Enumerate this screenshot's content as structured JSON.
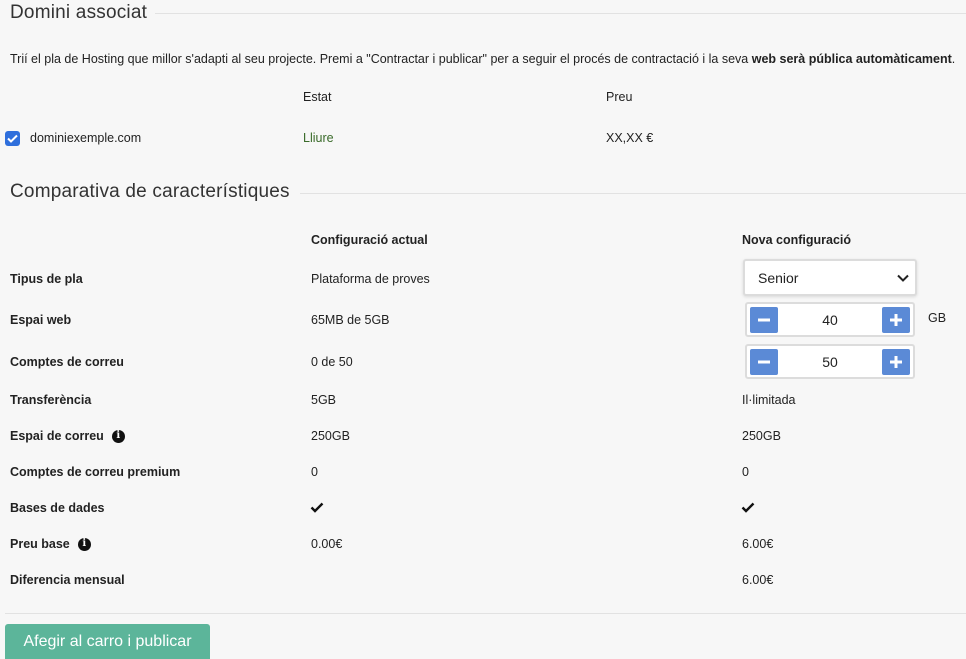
{
  "domain_section": {
    "title": "Domini associat",
    "intro_text": "Trií el pla de Hosting que millor s'adapti al seu projecte. Premi a \"Contractar i publicar\" per a seguir el procés de contractació i la seva ",
    "intro_bold": "web serà pública automàticament",
    "intro_end": ".",
    "col_status": "Estat",
    "col_price": "Preu",
    "domain": {
      "name": "dominiexemple.com",
      "checked": true,
      "status": "Lliure",
      "price": "XX,XX €"
    }
  },
  "comparison": {
    "title": "Comparativa de característiques",
    "col_current": "Configuració actual",
    "col_new": "Nova configuració",
    "rows": {
      "plan_type": {
        "label": "Tipus de pla",
        "current": "Plataforma de proves",
        "new_selected": "Senior"
      },
      "web_space": {
        "label": "Espai web",
        "current": "65MB de 5GB",
        "new_value": "40",
        "unit": "GB"
      },
      "mail_accounts": {
        "label": "Comptes de correu",
        "current": "0 de 50",
        "new_value": "50"
      },
      "transfer": {
        "label": "Transferència",
        "current": "5GB",
        "new": "Il·limitada"
      },
      "mail_space": {
        "label": "Espai de correu",
        "current": "250GB",
        "new": "250GB"
      },
      "premium_mail": {
        "label": "Comptes de correu premium",
        "current": "0",
        "new": "0"
      },
      "databases": {
        "label": "Bases de dades",
        "current": "included",
        "new": "included"
      },
      "base_price": {
        "label": "Preu base",
        "current": "0.00€",
        "new": "6.00€"
      },
      "monthly_diff": {
        "label": "Diferencia mensual",
        "current": "",
        "new": "6.00€"
      }
    }
  },
  "cta_label": "Afegir al carro i publicar",
  "colors": {
    "checkbox": "#2f6fdc",
    "stepper_button": "#5b8ad6",
    "cta": "#5cb59a",
    "status_free": "#3a6b2a"
  }
}
